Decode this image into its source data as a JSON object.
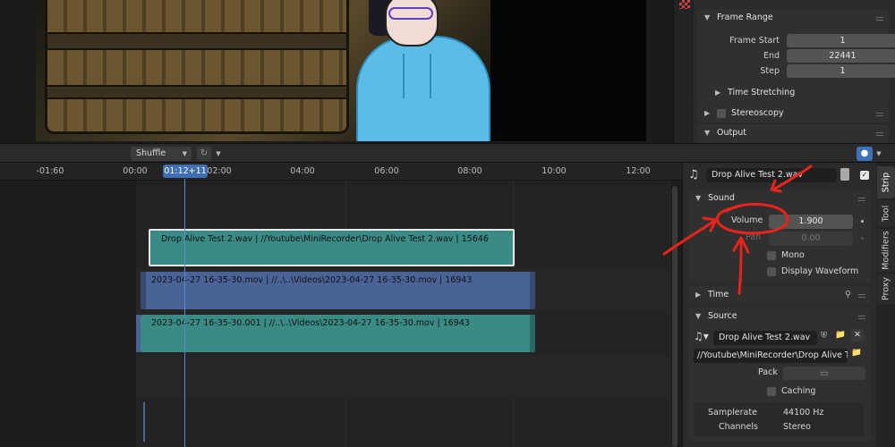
{
  "sequencer": {
    "mode_select": "Shuffle"
  },
  "properties": {
    "frame_range": {
      "header": "Frame Range",
      "start_label": "Frame Start",
      "start_value": "1",
      "end_label": "End",
      "end_value": "22441",
      "step_label": "Step",
      "step_value": "1"
    },
    "time_stretching": "Time Stretching",
    "stereoscopy": "Stereoscopy",
    "output": "Output"
  },
  "timeline": {
    "playhead": "01:12+11",
    "ticks": [
      "-01:60",
      "00:00",
      "02:00",
      "04:00",
      "06:00",
      "08:00",
      "10:00",
      "12:00"
    ],
    "strips": [
      {
        "label": "Drop Alive Test 2.wav | //Youtube\\MiniRecorder\\Drop Alive Test 2.wav | 15646",
        "kind": "sound",
        "selected": true
      },
      {
        "label": "2023-04-27 16-35-30.mov | //..\\..\\Videos\\2023-04-27 16-35-30.mov | 16943",
        "kind": "movie",
        "selected": false
      },
      {
        "label": "2023-04-27 16-35-30.001 | //..\\..\\Videos\\2023-04-27 16-35-30.mov | 16943",
        "kind": "sound",
        "selected": false
      }
    ]
  },
  "sidebar": {
    "strip_name": "Drop Alive Test 2.wav",
    "tabs": [
      "Strip",
      "Tool",
      "Modifiers",
      "Proxy"
    ],
    "sound": {
      "header": "Sound",
      "volume_label": "Volume",
      "volume_value": "1.900",
      "pan_label": "Pan",
      "pan_value": "0.00",
      "mono_label": "Mono",
      "display_waveform_label": "Display Waveform"
    },
    "time_header": "Time",
    "source": {
      "header": "Source",
      "sound_name": "Drop Alive Test 2.wav",
      "file_path": "//Youtube\\MiniRecorder\\Drop Alive Te...",
      "pack_label": "Pack",
      "caching_label": "Caching",
      "samplerate_label": "Samplerate",
      "samplerate_value": "44100 Hz",
      "channels_label": "Channels",
      "channels_value": "Stereo"
    }
  },
  "colors": {
    "sound_strip": "#3a8a86",
    "movie_strip": "#4a6396",
    "playhead": "#3f6fb2",
    "annotation": "#e8241c"
  }
}
